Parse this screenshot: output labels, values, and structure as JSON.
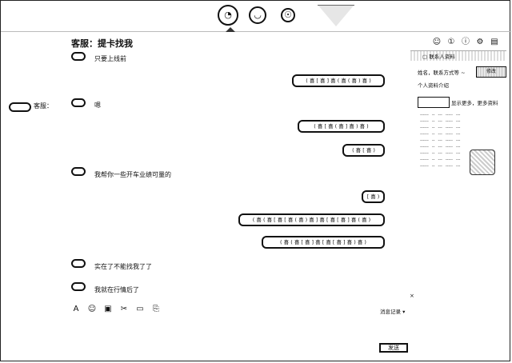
{
  "chat": {
    "title": "客服：提卡找我",
    "contact_label": "客服：",
    "messages_left": [
      "只要上线前",
      "嗯",
      "我帮你一些开车业绩可量的",
      "实在了不能找我了了",
      "我就在行情后了"
    ],
    "messages_right": [
      "( 喜 [ 喜 ] 喜 ( 喜 ( 喜 ) 喜 )",
      "( 喜 [ 喜 ( 喜 ] 喜 ) 喜 )",
      "( 喜 [ 喜 )",
      "[ 喜 )",
      "( 喜 ( 喜 [ 喜 [ 喜 ( 喜 ) 喜 ] 喜 [ 喜 [ 喜 ] 喜 ( 喜 )",
      "( 喜 ( 喜 [ 喜 ] 喜 [ 喜 [ 喜 ] 喜 ) 喜 )"
    ]
  },
  "composer": {
    "tools": [
      "A",
      "☺",
      "▣",
      "✂",
      "▭",
      "⎘"
    ],
    "hint": "消息记录 ▾",
    "send_label": "发送",
    "close_label": "×"
  },
  "right_panel": {
    "icons": [
      "☺",
      "①",
      "ⓘ",
      "⚙",
      "▤"
    ],
    "header": "▢ 联系人资料",
    "line1": "姓名，联系方式等 ~",
    "button": "修改",
    "line2": "个人资料介绍",
    "link": "显示更多，更多资料",
    "table_rows": [
      [
        "------",
        "--",
        "---",
        "-----",
        "---"
      ],
      [
        "------",
        "--",
        "---",
        "-----",
        "---"
      ],
      [
        "------",
        "--",
        "---",
        "-----",
        "---"
      ],
      [
        "------",
        "--",
        "---",
        "-----",
        "---"
      ],
      [
        "------",
        "--",
        "---",
        "-----",
        "---"
      ],
      [
        "------",
        "--",
        "---",
        "-----",
        "---"
      ],
      [
        "------",
        "--",
        "---",
        "-----",
        "---"
      ],
      [
        "------",
        "--",
        "---",
        "-----",
        "---"
      ],
      [
        "------",
        "--",
        "---",
        "-----",
        "---"
      ]
    ]
  },
  "topbar": {
    "icons": [
      "chat-icon",
      "user-icon",
      "settings-icon"
    ]
  }
}
